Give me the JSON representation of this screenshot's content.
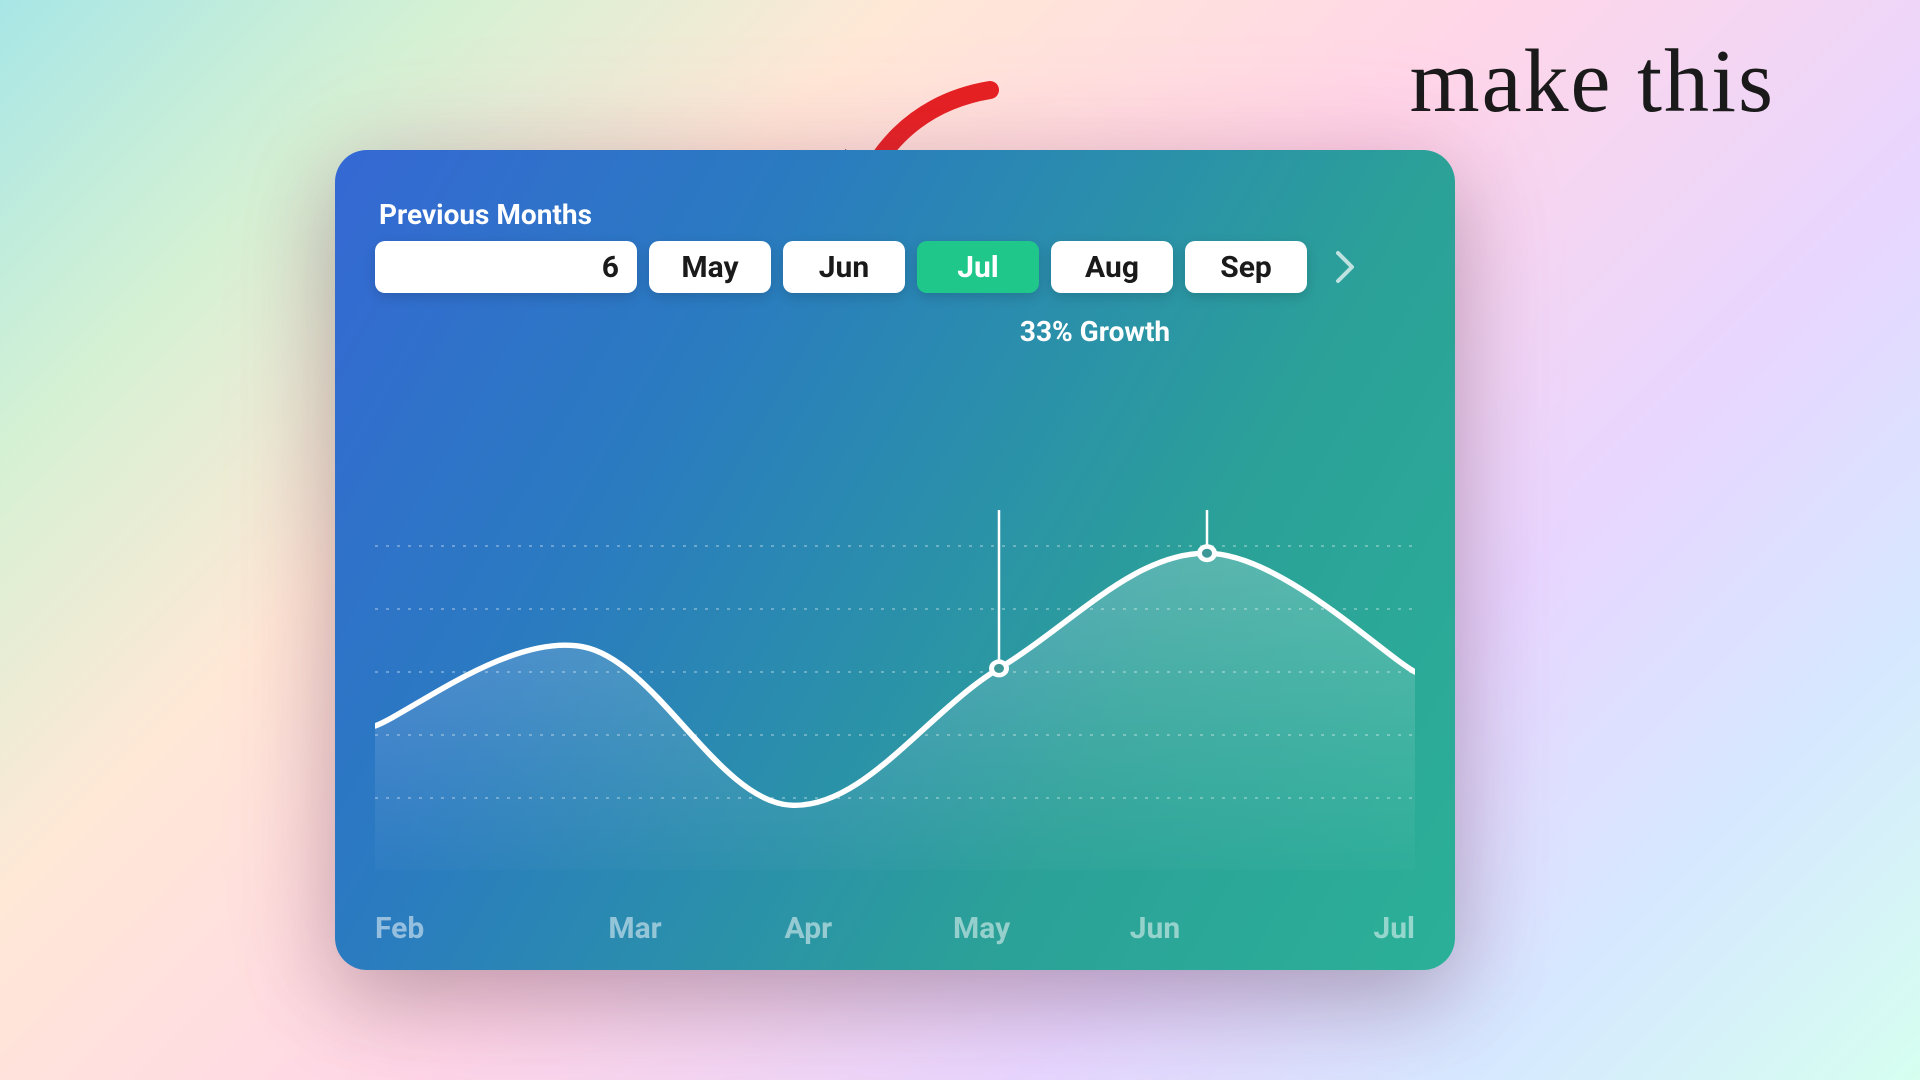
{
  "annotation": {
    "text": "make this"
  },
  "header": {
    "label": "Previous Months",
    "months_input_value": "6"
  },
  "month_buttons": [
    "May",
    "Jun",
    "Jul",
    "Aug",
    "Sep"
  ],
  "active_month": "Jul",
  "growth_label": "33% Growth",
  "x_ticks": [
    "Feb",
    "Mar",
    "Apr",
    "May",
    "Jun",
    "Jul"
  ],
  "colors": {
    "card_gradient_start": "#3568d4",
    "card_gradient_end": "#2bb098",
    "active_button": "#1fc88a",
    "arrow": "#e52020"
  },
  "chart_data": {
    "type": "area",
    "title": "",
    "xlabel": "",
    "ylabel": "",
    "ylim": [
      0,
      100
    ],
    "grid": true,
    "x": [
      "Feb",
      "Mar",
      "Apr",
      "May",
      "Jun",
      "Jul"
    ],
    "values": [
      40,
      62,
      18,
      56,
      88,
      55
    ],
    "annotations": [
      {
        "type": "marker",
        "x": "May",
        "y": 56
      },
      {
        "type": "marker",
        "x": "Jun",
        "y": 88
      },
      {
        "type": "bracket",
        "from": "May",
        "to": "Jun",
        "label": "33% Growth"
      }
    ]
  }
}
